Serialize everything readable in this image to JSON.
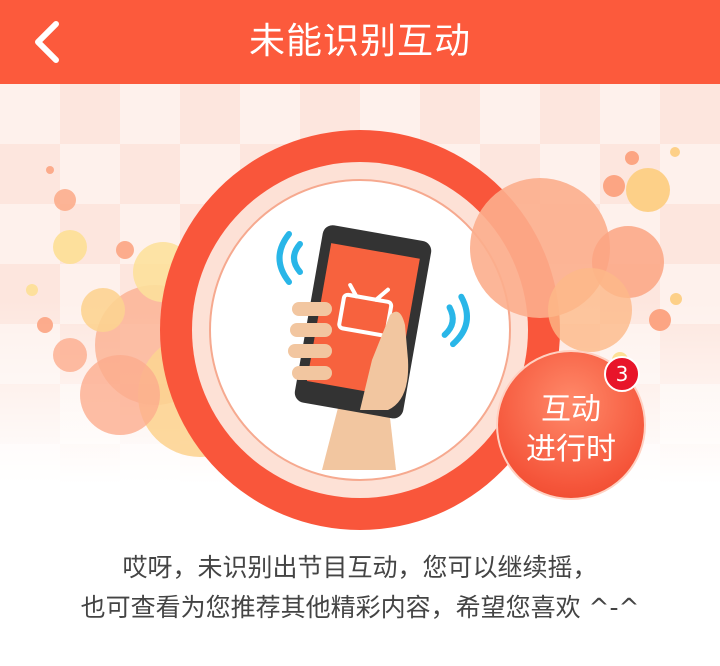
{
  "header": {
    "title": "未能识别互动",
    "back_icon": "chevron-left-icon"
  },
  "illustration": {
    "device_icon": "phone-tv-icon",
    "signal_icon": "wifi-signal-icon"
  },
  "badge": {
    "line1": "互动",
    "line2": "进行时",
    "count": "3"
  },
  "message": {
    "line1": "哎呀，未识别出节目互动，您可以继续摇，",
    "line2": "也可查看为您推荐其他精彩内容，希望您喜欢 ^-^"
  },
  "colors": {
    "header_bg": "#fc5a3c",
    "accent": "#f5553a",
    "badge_count": "#e8152a"
  }
}
